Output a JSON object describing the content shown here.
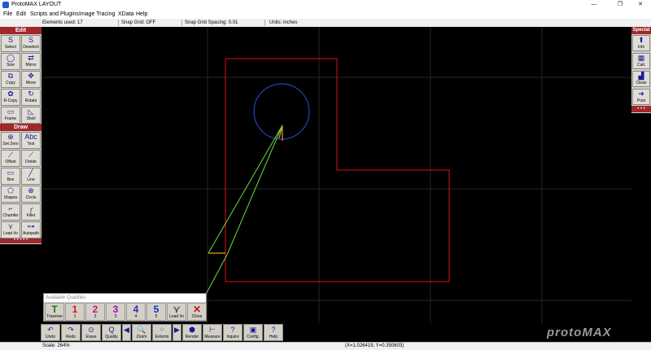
{
  "window": {
    "title": "ProtoMAX LAYOUT",
    "controls": [
      "—",
      "❐",
      "✕"
    ]
  },
  "menu": [
    "File",
    "Edit",
    "Scripts and Plugins",
    "Image Tracing",
    "XData",
    "Help"
  ],
  "status_top": {
    "elements": "Elements used: 17",
    "snap_grid": "Snap Grid: OFF",
    "snap_spacing": "Snap Grid Spacing: 0.01",
    "units": "Units: inches"
  },
  "edit_palette": {
    "header": "Edit",
    "tools": [
      {
        "label": "Select",
        "icon": "select-icon",
        "glyph": "S"
      },
      {
        "label": "Deselect",
        "icon": "deselect-icon",
        "glyph": "S"
      },
      {
        "label": "Size",
        "icon": "size-icon",
        "glyph": "◯"
      },
      {
        "label": "Mirror",
        "icon": "mirror-icon",
        "glyph": "⇄"
      },
      {
        "label": "Copy",
        "icon": "copy-icon",
        "glyph": "⧉"
      },
      {
        "label": "Move",
        "icon": "move-icon",
        "glyph": "✥"
      },
      {
        "label": "R-Copy",
        "icon": "rotate-copy-icon",
        "glyph": "✿"
      },
      {
        "label": "Rotate",
        "icon": "rotate-icon",
        "glyph": "↻"
      },
      {
        "label": "Frame",
        "icon": "frame-icon",
        "glyph": "▭"
      },
      {
        "label": "Shell",
        "icon": "shell-icon",
        "glyph": "◺"
      }
    ]
  },
  "draw_palette": {
    "header": "Draw",
    "tools": [
      {
        "label": "Set Zero",
        "icon": "set-zero-icon",
        "glyph": "⊕"
      },
      {
        "label": "Text",
        "icon": "text-icon",
        "glyph": "Abc"
      },
      {
        "label": "Offset",
        "icon": "offset-icon",
        "glyph": "⟋"
      },
      {
        "label": "Divide",
        "icon": "divide-icon",
        "glyph": "⟋"
      },
      {
        "label": "Box",
        "icon": "box-icon",
        "glyph": "▭"
      },
      {
        "label": "Line",
        "icon": "line-icon",
        "glyph": "╱"
      },
      {
        "label": "Shapes",
        "icon": "shapes-icon",
        "glyph": "⬠"
      },
      {
        "label": "Circle",
        "icon": "circle-icon",
        "glyph": "⊕"
      },
      {
        "label": "Chamfer",
        "icon": "chamfer-icon",
        "glyph": "⌐"
      },
      {
        "label": "Fillet",
        "icon": "fillet-icon",
        "glyph": "╭"
      },
      {
        "label": "Lead i/o",
        "icon": "lead-io-icon",
        "glyph": "⋎"
      },
      {
        "label": "Autopath",
        "icon": "autopath-icon",
        "glyph": "⊶"
      }
    ],
    "footer": "• • • • •"
  },
  "special_palette": {
    "header": "Special",
    "tools": [
      {
        "label": "Info",
        "icon": "info-icon",
        "glyph": "⬆"
      },
      {
        "label": "Calc",
        "icon": "calc-icon",
        "glyph": "▦"
      },
      {
        "label": "Clean",
        "icon": "clean-icon",
        "glyph": "▟"
      },
      {
        "label": "Post",
        "icon": "post-icon",
        "glyph": "➔"
      }
    ],
    "footer": "• • •"
  },
  "qualities": {
    "title": "Available Qualities",
    "buttons": [
      {
        "glyph": "T",
        "label": "Traverse",
        "color": "#1a7a1a"
      },
      {
        "glyph": "1",
        "label": "1",
        "color": "#d01010"
      },
      {
        "glyph": "2",
        "label": "2",
        "color": "#d0108a"
      },
      {
        "glyph": "3",
        "label": "3",
        "color": "#a010b0"
      },
      {
        "glyph": "4",
        "label": "4",
        "color": "#4020c0"
      },
      {
        "glyph": "5",
        "label": "5",
        "color": "#1030c0"
      },
      {
        "glyph": "⋎",
        "label": "Lead i/o",
        "color": "#555555"
      },
      {
        "glyph": "✕",
        "label": "Close",
        "color": "#d01010"
      }
    ]
  },
  "bottom_toolbar": [
    {
      "label": "Undo",
      "icon": "undo-icon",
      "glyph": "↶"
    },
    {
      "label": "Redo",
      "icon": "redo-icon",
      "glyph": "↷"
    },
    {
      "label": "Erase",
      "icon": "erase-icon",
      "glyph": "⊙"
    },
    {
      "label": "Quality",
      "icon": "quality-icon",
      "glyph": "Q"
    },
    {
      "label": "",
      "icon": "arrow-left-icon",
      "glyph": "◀"
    },
    {
      "label": "Zoom",
      "icon": "zoom-icon",
      "glyph": "🔍"
    },
    {
      "label": "Extents",
      "icon": "extents-icon",
      "glyph": "⁘"
    },
    {
      "label": "",
      "icon": "arrow-right-icon",
      "glyph": "▶"
    },
    {
      "label": "Render",
      "icon": "render-icon",
      "glyph": "⬢"
    },
    {
      "label": "Measure",
      "icon": "measure-icon",
      "glyph": "⊢"
    },
    {
      "label": "Inquire",
      "icon": "inquire-icon",
      "glyph": "?"
    },
    {
      "label": "Config.",
      "icon": "config-icon",
      "glyph": "▣"
    },
    {
      "label": "Help",
      "icon": "help-icon",
      "glyph": "?"
    }
  ],
  "logo": "protoMAX",
  "status_bottom": {
    "scale": "Scale: 264%",
    "coords": "(X=1.026419, Y=0.350603)"
  },
  "colors": {
    "part_outline": "#e01010",
    "circle": "#2255dd",
    "lead_path": "#66dd44",
    "lead_orange": "#e0a020",
    "grid": "#333333",
    "header": "#a0282b"
  }
}
